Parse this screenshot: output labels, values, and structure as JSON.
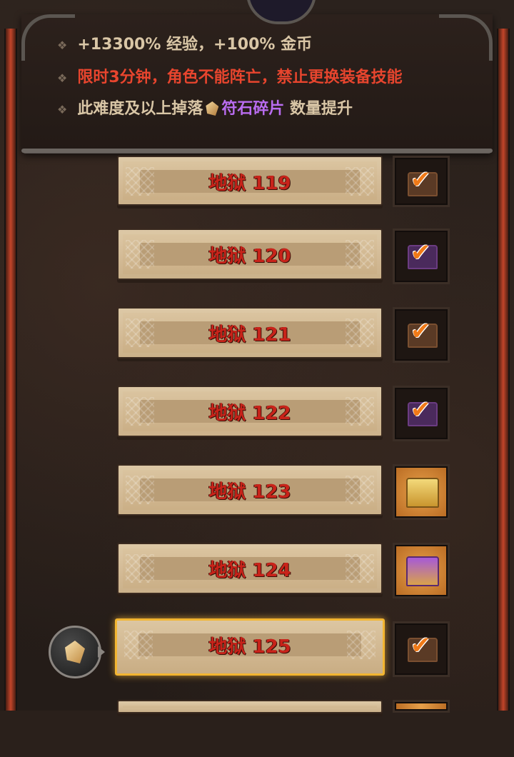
{
  "info": {
    "line1": "+13300% 经验，+100% 金币",
    "line2": "限时3分钟，角色不能阵亡，禁止更换装备技能",
    "line3_prefix": "此难度及以上掉落",
    "line3_item": "符石碎片",
    "line3_suffix": "数量提升",
    "bullet": "❖"
  },
  "colors": {
    "accent_red": "#e8452e",
    "rune_purple": "#b96cf0",
    "label_red": "#c8231a",
    "highlight_gold": "#f2b531"
  },
  "levels": [
    {
      "label": "地狱 119",
      "reward": "chest-claimed",
      "check": "✔"
    },
    {
      "label": "地狱 120",
      "reward": "chest-purple-claimed",
      "check": "✔"
    },
    {
      "label": "地狱 121",
      "reward": "chest-claimed",
      "check": "✔"
    },
    {
      "label": "地狱 122",
      "reward": "chest-purple-claimed",
      "check": "✔"
    },
    {
      "label": "地狱 123",
      "reward": "chest-gold-unclaimed",
      "check": ""
    },
    {
      "label": "地狱 124",
      "reward": "chest-purple-unclaimed",
      "check": ""
    },
    {
      "label": "地狱 125",
      "reward": "chest-claimed",
      "check": "✔",
      "current": true
    }
  ],
  "player_marker": {
    "icon": "rune-shard-icon"
  }
}
